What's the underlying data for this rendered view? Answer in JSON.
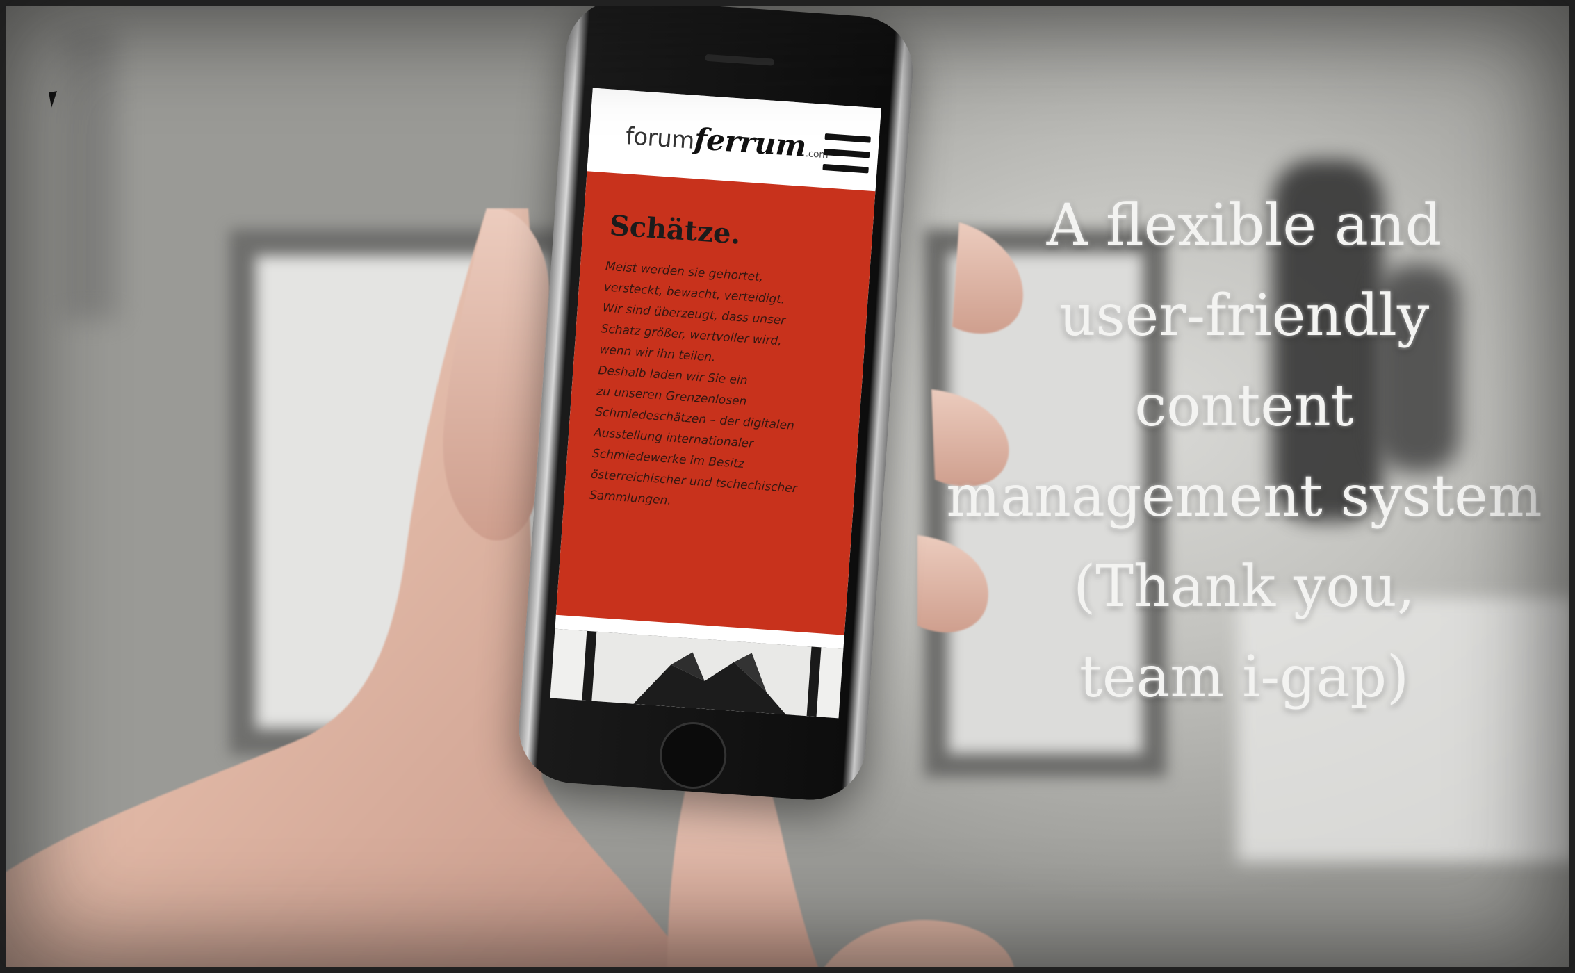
{
  "phone_site": {
    "logo_light": "forum",
    "logo_bold": "ferrum",
    "logo_tld": ".com",
    "menu_icon": "hamburger-menu-icon",
    "heading": "Schätze.",
    "body_lines": [
      "Meist werden sie gehortet,",
      "versteckt, bewacht, verteidigt.",
      "Wir sind überzeugt, dass unser",
      "Schatz größer, wertvoller wird,",
      "wenn wir ihn teilen.",
      "Deshalb laden wir Sie ein",
      "zu unseren Grenzenlosen",
      "Schmiedeschätzen – der digitalen",
      "Ausstellung internationaler",
      "Schmiedewerke im Besitz",
      "österreichischer und tschechischer",
      "Sammlungen."
    ],
    "accent_color": "#c8321c"
  },
  "overlay_text": [
    "A flexible and",
    "user-friendly",
    "content",
    "management system",
    "(Thank you,",
    "team i-gap)"
  ],
  "cursor_icon": "arrow-cursor-icon"
}
